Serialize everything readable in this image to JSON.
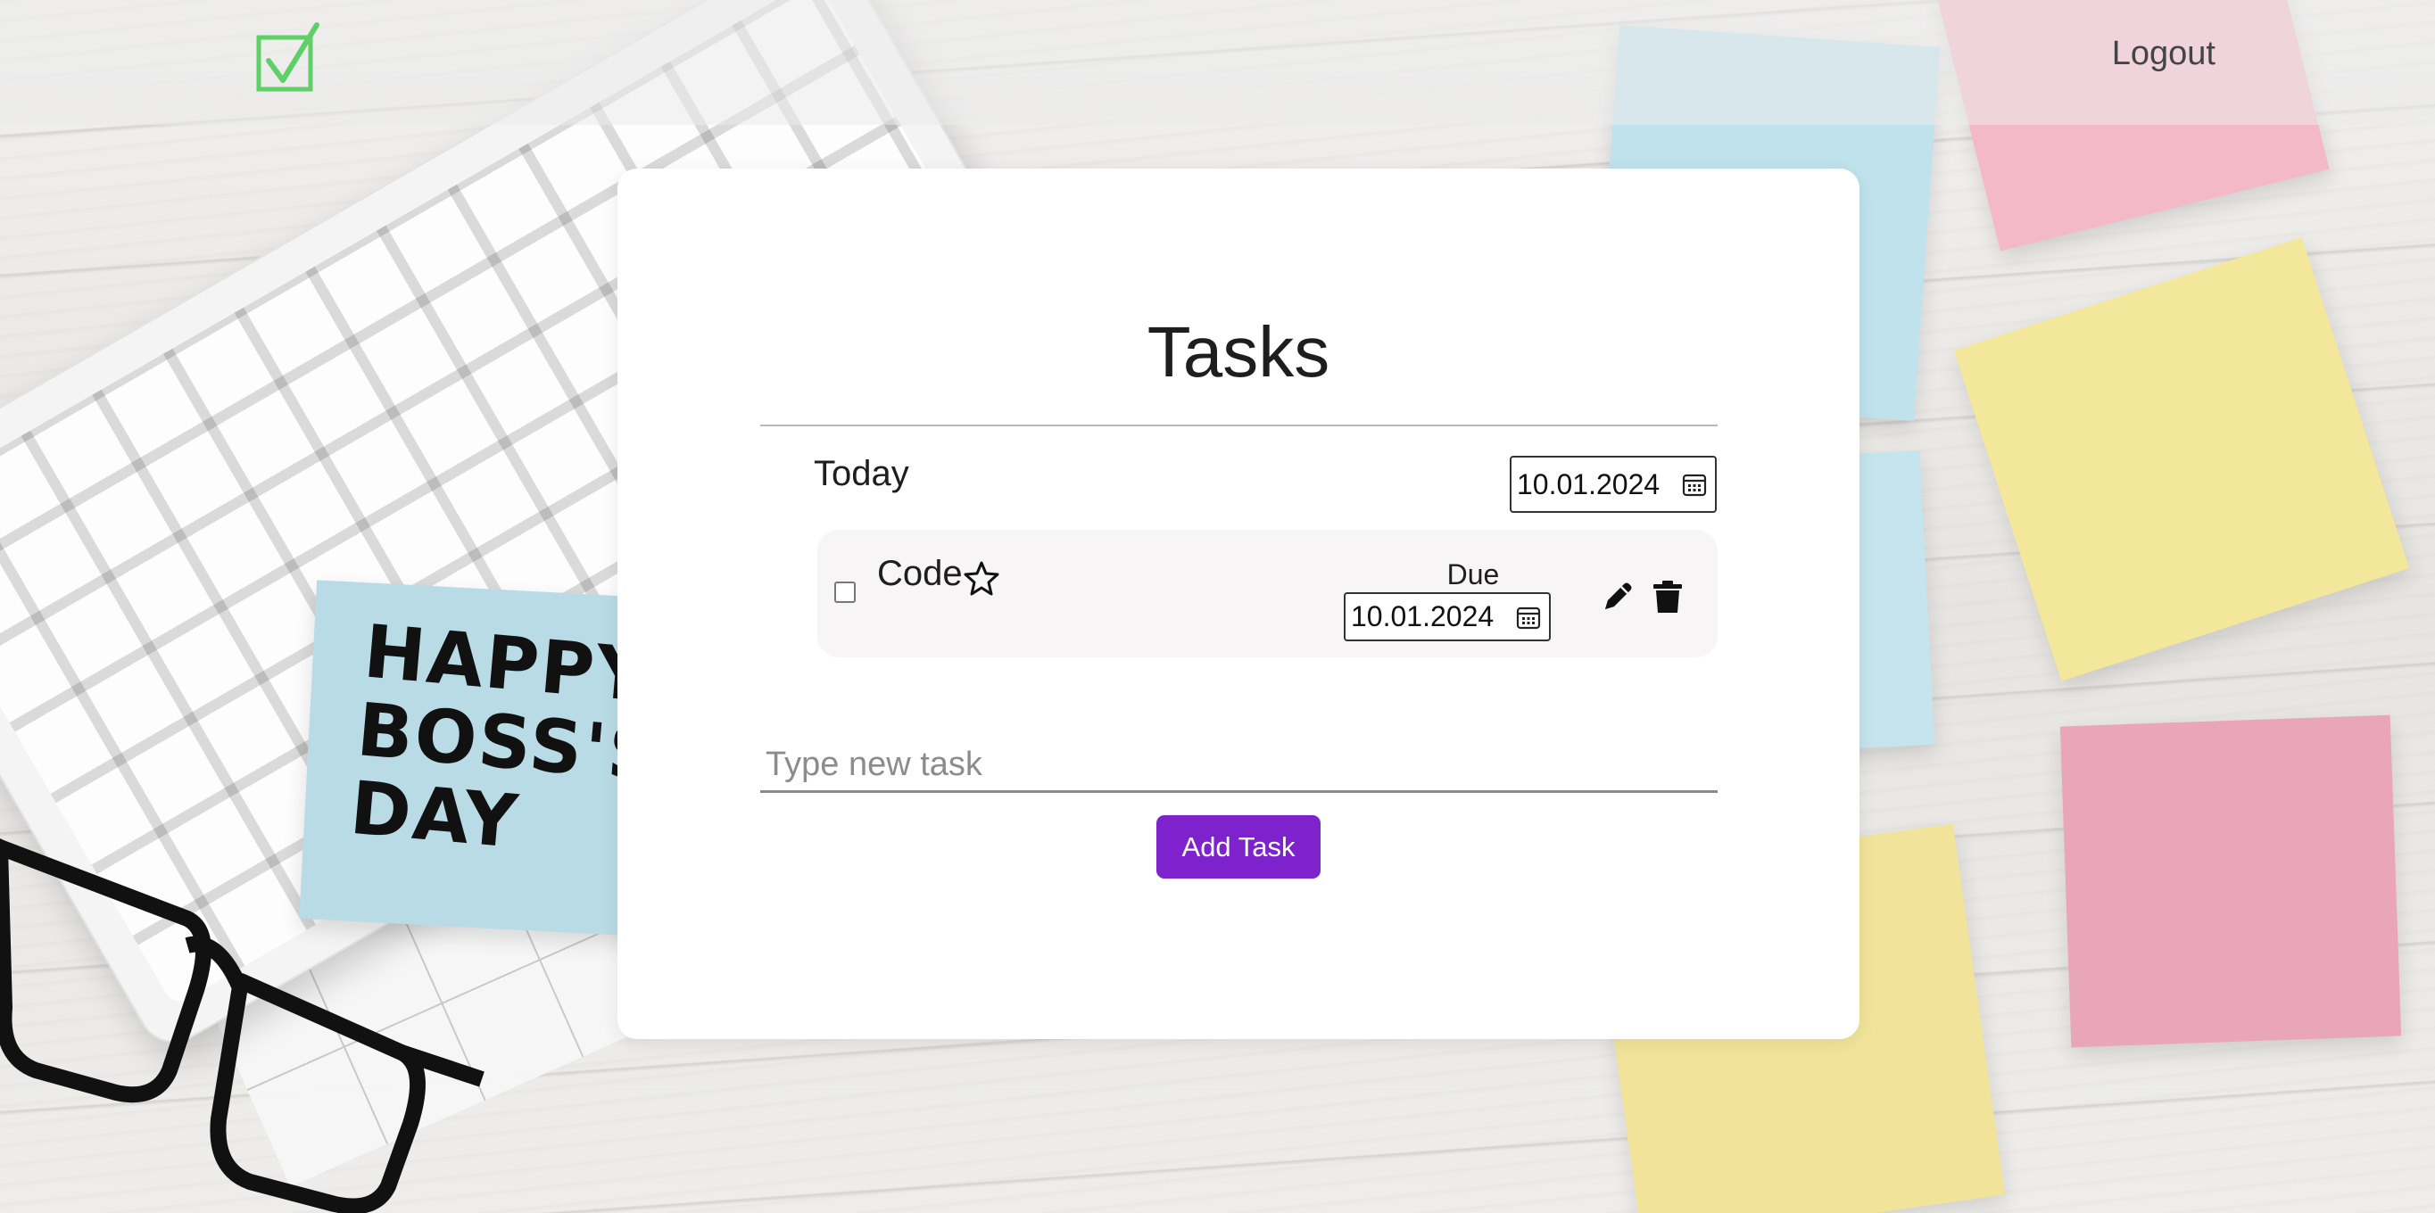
{
  "header": {
    "logo_icon": "checkbox-check-icon",
    "logout_label": "Logout"
  },
  "background": {
    "sticky_note_text": "HAPPY BOSS'S DAY"
  },
  "main": {
    "title": "Tasks",
    "section_label": "Today",
    "section_date": "10.01.2024",
    "tasks": [
      {
        "name": "Code",
        "completed": false,
        "starred": false,
        "due_label": "Due",
        "due_date": "10.01.2024"
      }
    ],
    "new_task": {
      "value": "",
      "placeholder": "Type new task"
    },
    "add_button_label": "Add Task"
  },
  "colors": {
    "accent": "#7e22ce",
    "logo": "#5fd068"
  }
}
